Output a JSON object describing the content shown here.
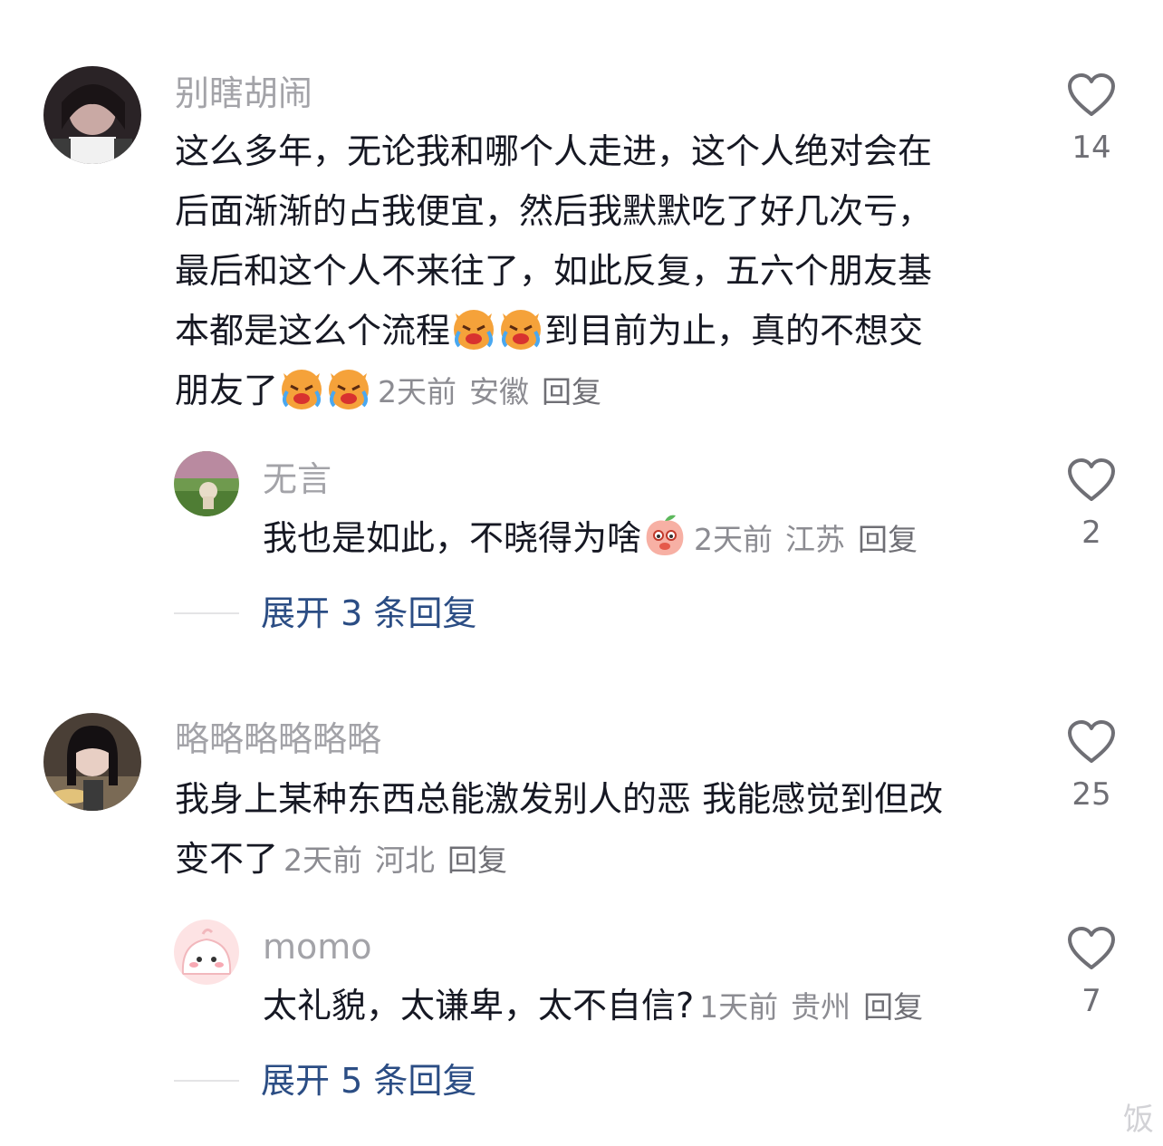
{
  "comments": [
    {
      "username": "别瞎胡闹",
      "text_lines": [
        "这么多年，无论我和哪个人走进，这个人绝对会在",
        "后面渐渐的占我便宜，然后我默默吃了好几次亏，",
        "最后和这个人不来往了，如此反复，五六个朋友基"
      ],
      "text_line4": "本都是这么个流程",
      "text_line4_after": "到目前为止，真的不想交",
      "text_line5": "朋友了",
      "time": "2天前",
      "location": "安徽",
      "reply_label": "回复",
      "like_count": "14",
      "reply": {
        "username": "无言",
        "text": "我也是如此，不晓得为啥",
        "time": "2天前",
        "location": "江苏",
        "reply_label": "回复",
        "like_count": "2"
      },
      "expand_label": "展开 3 条回复"
    },
    {
      "username": "略略略略略略",
      "text_line1": "我身上某种东西总能激发别人的恶 我能感觉到但改",
      "text_line2": "变不了",
      "time": "2天前",
      "location": "河北",
      "reply_label": "回复",
      "like_count": "25",
      "reply": {
        "username": "momo",
        "text": "太礼貌，太谦卑，太不自信?",
        "time": "1天前",
        "location": "贵州",
        "reply_label": "回复",
        "like_count": "7"
      },
      "expand_label": "展开 5 条回复"
    }
  ],
  "icons": {
    "like": "heart-outline-icon",
    "emoji_cry_cat": "crying-cat-emoji",
    "emoji_peach": "shy-peach-emoji"
  },
  "watermark": "饭"
}
